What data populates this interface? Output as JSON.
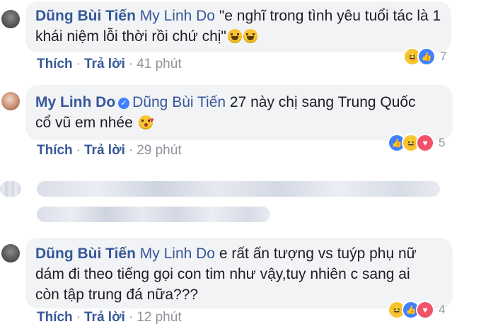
{
  "comments": [
    {
      "author": "Dũng Bùi Tiến",
      "tag": "My Linh Do",
      "text": "\"e nghĩ trong tình yêu tuổi tác là 1 khái niệm lỗi thời rồi chứ chị\"",
      "emojis": [
        "grinning-face-emoji",
        "grinning-face-emoji"
      ],
      "actions": {
        "like": "Thích",
        "reply": "Trả lời",
        "time": "41 phút"
      },
      "reactions": {
        "icons": [
          "haha-reaction-icon",
          "like-reaction-icon"
        ],
        "count": "7"
      }
    },
    {
      "author": "My Linh Do",
      "tag": "Dũng Bùi Tiến",
      "line1": "27 này chị sang Trung Quốc",
      "line2": "cổ vũ em nhée",
      "emojis": [
        "kissing-face-emoji"
      ],
      "actions": {
        "like": "Thích",
        "reply": "Trả lời",
        "time": "29 phút"
      },
      "reactions": {
        "icons": [
          "like-reaction-icon",
          "haha-reaction-icon",
          "love-reaction-icon"
        ],
        "count": "5"
      }
    },
    {
      "author": "Dũng Bùi Tiến",
      "tag": "My Linh Do",
      "line1": "e rất ấn tượng vs tuýp phụ nữ",
      "line2": "dám đi theo tiếng gọi con tim như vậy,tuy nhiên c sang ai",
      "line3": "còn tập trung đá nữa???",
      "actions": {
        "like": "Thích",
        "reply": "Trả lời",
        "time": "12 phút"
      },
      "reactions": {
        "icons": [
          "haha-reaction-icon",
          "like-reaction-icon",
          "love-reaction-icon"
        ],
        "count": "4"
      }
    }
  ],
  "colors": {
    "link": "#365899",
    "meta": "#90949c",
    "bubble": "#f2f3f5",
    "like": "#4080ff",
    "love": "#f25268",
    "haha": "#f7c531"
  }
}
